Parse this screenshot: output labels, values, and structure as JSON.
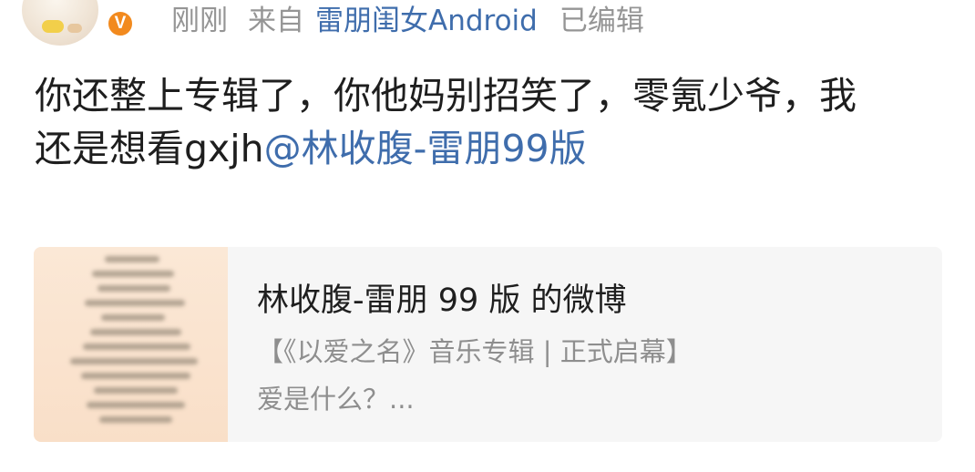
{
  "header": {
    "time": "刚刚",
    "from_label": "来自",
    "source": "雷朋闺女Android",
    "edited": "已编辑",
    "verified_badge": "V",
    "colors": {
      "meta_gray": "#959595",
      "link_blue": "#3f6dac",
      "badge_orange": "#f28a1e"
    }
  },
  "post": {
    "text_line1": "你还整上专辑了，你他妈别招笑了，零氪少爷，我",
    "text_line2": "还是想看gxjh",
    "mention": "@林收腹-雷朋99版"
  },
  "card": {
    "title": "林收腹-雷朋 99 版 的微博",
    "subtitle": "【《以爱之名》音乐专辑 | 正式启幕】",
    "description": "爱是什么？..."
  }
}
